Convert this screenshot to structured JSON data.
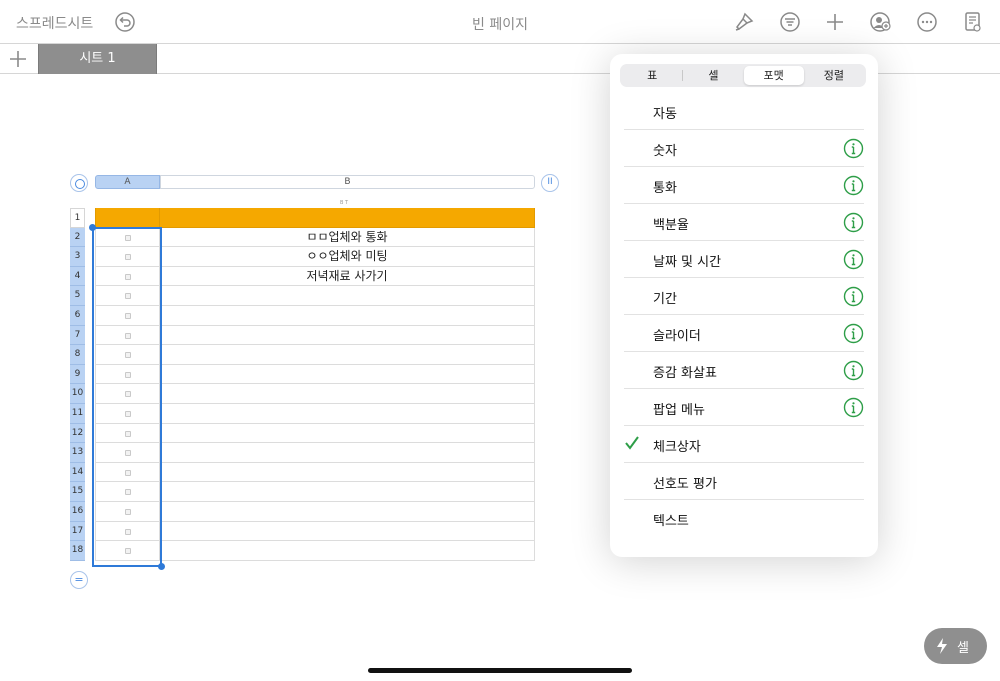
{
  "toolbar": {
    "back_label": "스프레드시트",
    "title": "빈 페이지",
    "icons": [
      "undo-icon",
      "format-brush-icon",
      "organize-icon",
      "add-icon",
      "collaborate-icon",
      "more-icon",
      "document-view-icon"
    ],
    "accent_color": "#8a8a8a"
  },
  "sheets": {
    "add_icon": "plus-icon",
    "tabs": [
      {
        "label": "시트 1",
        "active": true
      }
    ]
  },
  "table": {
    "columns": [
      "A",
      "B"
    ],
    "column_b_tiny": "B T",
    "row_numbers": [
      "1",
      "2",
      "3",
      "4",
      "5",
      "6",
      "7",
      "8",
      "9",
      "10",
      "11",
      "12",
      "13",
      "14",
      "15",
      "16",
      "17",
      "18"
    ],
    "header_color": "#f5a800",
    "column_b_values": [
      "",
      "ㅁㅁ업체와 통화",
      "ㅇㅇ업체와 미팅",
      "저녁재료 사가기",
      "",
      "",
      "",
      "",
      "",
      "",
      "",
      "",
      "",
      "",
      "",
      "",
      "",
      ""
    ],
    "selected_column": "A",
    "selection_color": "#2f7ad8",
    "add_row_icon": "equals-icon",
    "column_handle": "II"
  },
  "popover": {
    "tabs": [
      {
        "label": "표",
        "active": false
      },
      {
        "label": "셀",
        "active": false
      },
      {
        "label": "포맷",
        "active": true
      },
      {
        "label": "정렬",
        "active": false
      }
    ],
    "formats": [
      {
        "label": "자동",
        "info": false,
        "checked": false
      },
      {
        "label": "숫자",
        "info": true,
        "checked": false
      },
      {
        "label": "통화",
        "info": true,
        "checked": false
      },
      {
        "label": "백분율",
        "info": true,
        "checked": false
      },
      {
        "label": "날짜 및 시간",
        "info": true,
        "checked": false
      },
      {
        "label": "기간",
        "info": true,
        "checked": false
      },
      {
        "label": "슬라이더",
        "info": true,
        "checked": false
      },
      {
        "label": "증감 화살표",
        "info": true,
        "checked": false
      },
      {
        "label": "팝업 메뉴",
        "info": true,
        "checked": false
      },
      {
        "label": "체크상자",
        "info": false,
        "checked": true
      },
      {
        "label": "선호도 평가",
        "info": false,
        "checked": false
      },
      {
        "label": "텍스트",
        "info": false,
        "checked": false
      }
    ],
    "info_color": "#2e9e48",
    "check_color": "#2e9e48"
  },
  "cell_button": {
    "label": "셀",
    "icon": "lightning-icon"
  }
}
